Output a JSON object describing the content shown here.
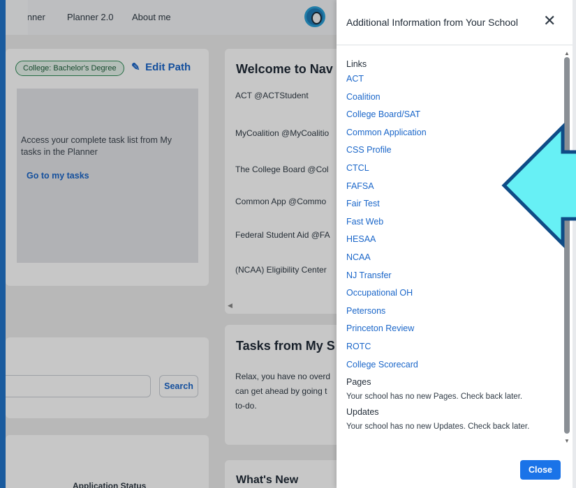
{
  "nav": {
    "planner": "Planner",
    "planner2": "Planner 2.0",
    "about": "About me"
  },
  "path_card": {
    "badge": "College: Bachelor's Degree",
    "edit_label": "Edit Path",
    "tasks_text": "Access your complete task list from My tasks in the Planner",
    "tasks_link": "Go to my tasks"
  },
  "welcome": {
    "title": "Welcome to Nav",
    "socials": [
      "ACT @ACTStudent",
      "MyCoalition @MyCoalitio",
      "The College Board @Col",
      "Common App @Commo",
      "Federal Student Aid @FA",
      "(NCAA) Eligibility Center"
    ]
  },
  "search": {
    "button": "Search"
  },
  "tasks_school": {
    "title": "Tasks from My S",
    "body": "Relax, you have no overd can get ahead by going t to-do."
  },
  "whats_new": "What's New",
  "application_status": "Application Status",
  "panel": {
    "title": "Additional Information from Your School",
    "links_title": "Links",
    "links": [
      "ACT",
      "Coalition",
      "College Board/SAT",
      "Common Application",
      "CSS Profile",
      "CTCL",
      "FAFSA",
      "Fair Test",
      "Fast Web",
      "HESAA",
      "NCAA",
      "NJ Transfer",
      "Occupational OH",
      "Petersons",
      "Princeton Review",
      "ROTC",
      "College Scorecard"
    ],
    "pages_title": "Pages",
    "pages_note": "Your school has no new Pages. Check back later.",
    "updates_title": "Updates",
    "updates_note": "Your school has no new Updates. Check back later.",
    "close_label": "Close"
  },
  "colors": {
    "accent": "#1a73e8",
    "link": "#1a66c9",
    "frame": "#1a5b9e",
    "arrow_fill": "#67f0f5",
    "arrow_stroke": "#0f4b86"
  }
}
